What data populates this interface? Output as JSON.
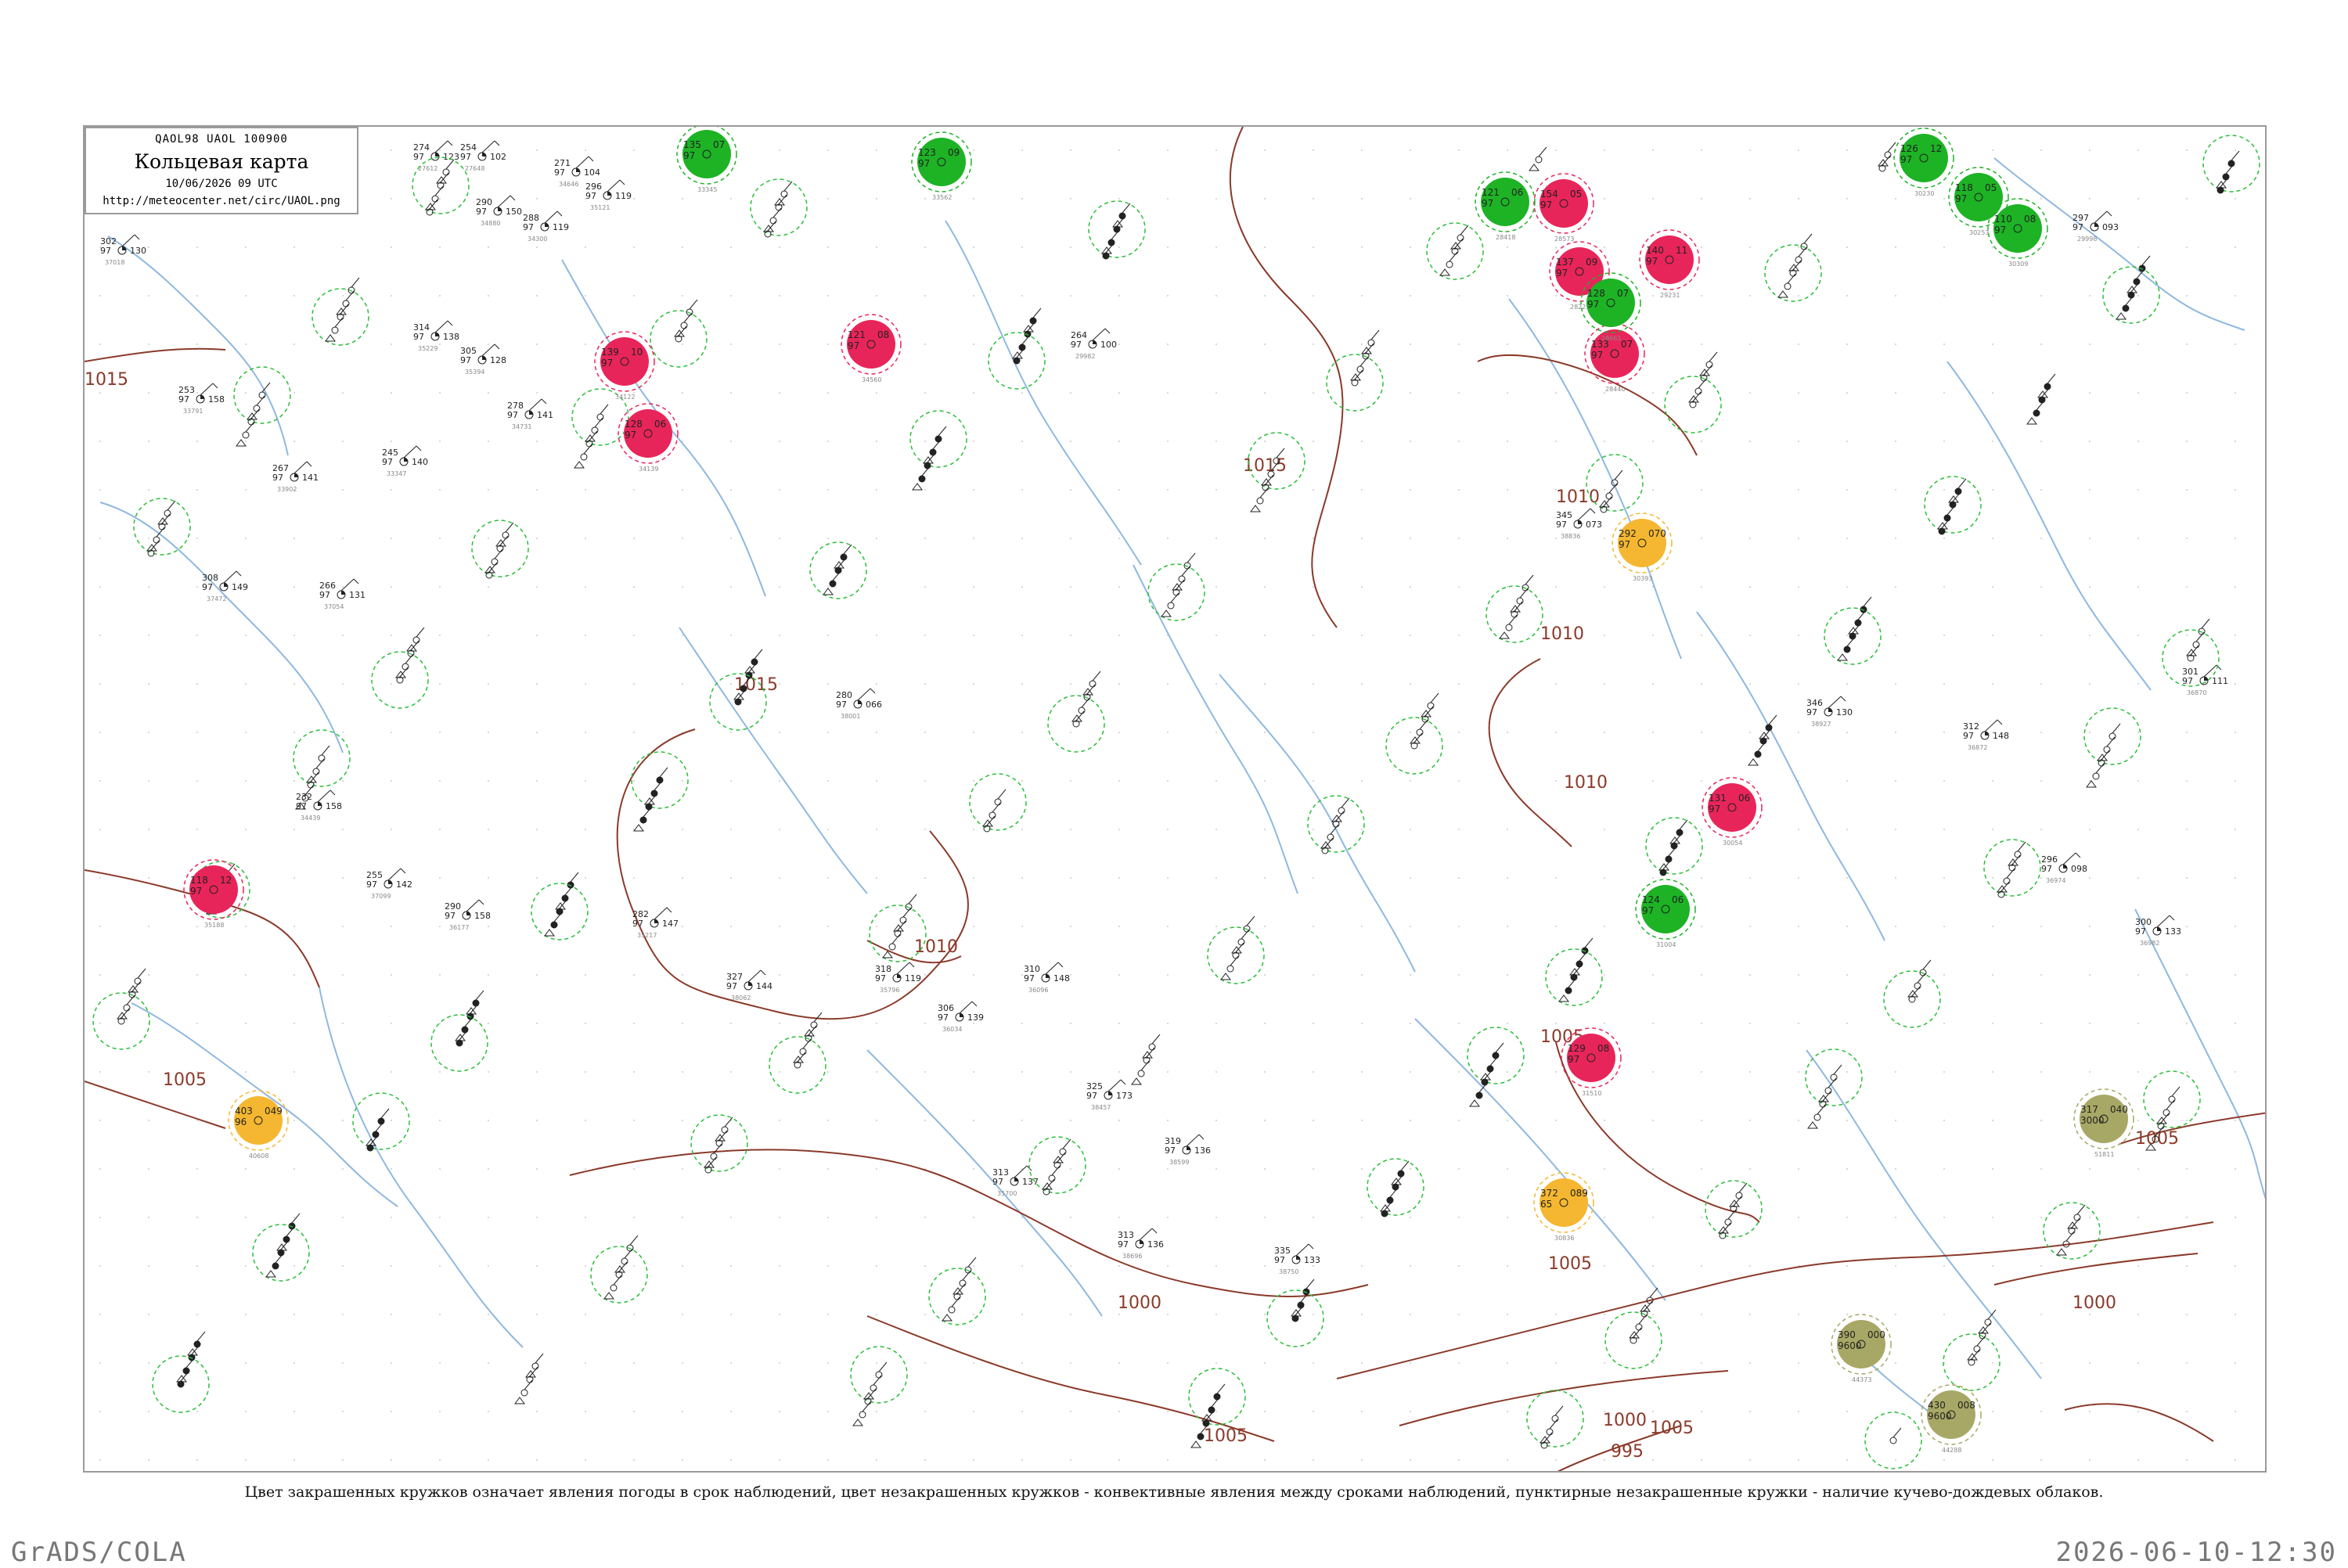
{
  "header": {
    "code": "QAOL98  UAOL  100900",
    "title": "Кольцевая карта",
    "date": "10/06/2026 09 UTC",
    "url": "http://meteocenter.net/circ/UAOL.png"
  },
  "caption": "Цвет закрашенных кружков означает явления погоды в срок наблюдений, цвет незакрашенных кружков - конвективные явления между сроками наблюдений, пунктирные незакрашенные кружки - наличие кучево-дождевых облаков.",
  "footer": {
    "left": "GrADS/COLA",
    "right": "2026-06-10-12:30"
  },
  "colors": {
    "isobar": "#8b3a2a",
    "river": "#8fb8e0",
    "thunder_red": "#e8255a",
    "rain_green": "#1db325",
    "haze_orange": "#f5b731",
    "dust_olive": "#a8a866",
    "cb_dash": "#2bbf3a"
  },
  "isobar_labels": [
    "1015",
    "1015",
    "1015",
    "1010",
    "1010",
    "1010",
    "1010",
    "1005",
    "1005",
    "1005",
    "1005",
    "1005",
    "1005",
    "1000",
    "1000",
    "995",
    "1000"
  ],
  "stations_red": [
    {
      "top": "139",
      "left": "97",
      "right": "10",
      "id": "34122"
    },
    {
      "top": "128",
      "left": "97",
      "right": "06",
      "id": "34139"
    },
    {
      "top": "121",
      "left": "97",
      "right": "08",
      "id": "34560"
    },
    {
      "top": "118",
      "left": "97",
      "right": "12",
      "id": "35188"
    },
    {
      "top": "154",
      "left": "97",
      "right": "05",
      "id": "28573"
    },
    {
      "top": "137",
      "left": "97",
      "right": "09",
      "id": "28225"
    },
    {
      "top": "133",
      "left": "97",
      "right": "07",
      "id": "28440"
    },
    {
      "top": "140",
      "left": "97",
      "right": "11",
      "id": "29231"
    },
    {
      "top": "131",
      "left": "97",
      "right": "06",
      "id": "30054"
    },
    {
      "top": "129",
      "left": "97",
      "right": "08",
      "id": "31510"
    }
  ],
  "stations_green": [
    {
      "top": "135",
      "left": "97",
      "right": "07",
      "id": "33345"
    },
    {
      "top": "123",
      "left": "97",
      "right": "09",
      "id": "33562"
    },
    {
      "top": "121",
      "left": "97",
      "right": "06",
      "id": "28418"
    },
    {
      "top": "128",
      "left": "97",
      "right": "07",
      "id": "28661"
    },
    {
      "top": "126",
      "left": "97",
      "right": "12",
      "id": "30230"
    },
    {
      "top": "118",
      "left": "97",
      "right": "05",
      "id": "30253"
    },
    {
      "top": "110",
      "left": "97",
      "right": "08",
      "id": "30309"
    },
    {
      "top": "124",
      "left": "97",
      "right": "06",
      "id": "31004"
    }
  ],
  "stations_orange": [
    {
      "top": "292",
      "left": "97",
      "right": "070",
      "id": "30393"
    },
    {
      "top": "403",
      "left": "96",
      "right": "049",
      "id": "40608"
    },
    {
      "top": "372",
      "left": "65",
      "right": "089",
      "id": "30836"
    }
  ],
  "stations_olive": [
    {
      "top": "317",
      "left": "3000",
      "right": "040",
      "id": "51811"
    },
    {
      "top": "390",
      "left": "9600",
      "right": "000",
      "id": "44373"
    },
    {
      "top": "430",
      "left": "9600",
      "right": "008",
      "id": "44288"
    }
  ],
  "stations_plain": [
    {
      "top": "274",
      "left": "97",
      "right": "123",
      "id": "27612"
    },
    {
      "top": "254",
      "left": "97",
      "right": "102",
      "id": "27648"
    },
    {
      "top": "288",
      "left": "97",
      "right": "119",
      "id": "34300"
    },
    {
      "top": "271",
      "left": "97",
      "right": "104",
      "id": "34646"
    },
    {
      "top": "290",
      "left": "97",
      "right": "150",
      "id": "34880"
    },
    {
      "top": "296",
      "left": "97",
      "right": "119",
      "id": "35121"
    },
    {
      "top": "314",
      "left": "97",
      "right": "138",
      "id": "35229"
    },
    {
      "top": "305",
      "left": "97",
      "right": "128",
      "id": "35394"
    },
    {
      "top": "278",
      "left": "97",
      "right": "141",
      "id": "34731"
    },
    {
      "top": "245",
      "left": "97",
      "right": "140",
      "id": "33347"
    },
    {
      "top": "267",
      "left": "97",
      "right": "141",
      "id": "33902"
    },
    {
      "top": "253",
      "left": "97",
      "right": "158",
      "id": "33791"
    },
    {
      "top": "302",
      "left": "97",
      "right": "130",
      "id": "37018"
    },
    {
      "top": "308",
      "left": "97",
      "right": "149",
      "id": "37472"
    },
    {
      "top": "266",
      "left": "97",
      "right": "131",
      "id": "37054"
    },
    {
      "top": "232",
      "left": "97",
      "right": "158",
      "id": "34439"
    },
    {
      "top": "255",
      "left": "97",
      "right": "142",
      "id": "37099"
    },
    {
      "top": "290",
      "left": "97",
      "right": "158",
      "id": "36177"
    },
    {
      "top": "282",
      "left": "97",
      "right": "147",
      "id": "35217"
    },
    {
      "top": "280",
      "left": "97",
      "right": "066",
      "id": "38001"
    },
    {
      "top": "327",
      "left": "97",
      "right": "144",
      "id": "38062"
    },
    {
      "top": "313",
      "left": "97",
      "right": "137",
      "id": "35700"
    },
    {
      "top": "318",
      "left": "97",
      "right": "119",
      "id": "35796"
    },
    {
      "top": "306",
      "left": "97",
      "right": "139",
      "id": "36034"
    },
    {
      "top": "310",
      "left": "97",
      "right": "148",
      "id": "36096"
    },
    {
      "top": "325",
      "left": "97",
      "right": "173",
      "id": "38457"
    },
    {
      "top": "319",
      "left": "97",
      "right": "136",
      "id": "38599"
    },
    {
      "top": "313",
      "left": "97",
      "right": "136",
      "id": "38696"
    },
    {
      "top": "335",
      "left": "97",
      "right": "133",
      "id": "38750"
    },
    {
      "top": "345",
      "left": "97",
      "right": "073",
      "id": "38836"
    },
    {
      "top": "346",
      "left": "97",
      "right": "130",
      "id": "38927"
    },
    {
      "top": "312",
      "left": "97",
      "right": "148",
      "id": "36872"
    },
    {
      "top": "301",
      "left": "97",
      "right": "111",
      "id": "36870"
    },
    {
      "top": "296",
      "left": "97",
      "right": "098",
      "id": "36974"
    },
    {
      "top": "300",
      "left": "97",
      "right": "133",
      "id": "36982"
    },
    {
      "top": "297",
      "left": "97",
      "right": "093",
      "id": "29998"
    },
    {
      "top": "264",
      "left": "97",
      "right": "100",
      "id": "29982"
    }
  ]
}
